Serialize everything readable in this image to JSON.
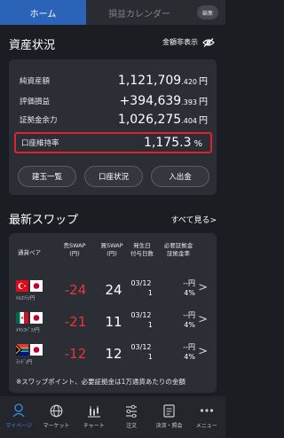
{
  "tabs": {
    "home": "ホーム",
    "calendar": "損益カレンダー",
    "edit": "編集"
  },
  "assets": {
    "title": "資産状況",
    "hide_label": "金額非表示",
    "rows": [
      {
        "label": "純資産額",
        "big": "1,121,709",
        "small": ".420",
        "unit": "円"
      },
      {
        "label": "評価損益",
        "big": "+394,639",
        "small": ".393",
        "unit": "円"
      },
      {
        "label": "証拠金余力",
        "big": "1,026,275",
        "small": ".404",
        "unit": "円"
      }
    ],
    "margin_rate": {
      "label": "口座維持率",
      "value": "1,175.3",
      "unit": "%"
    },
    "buttons": [
      "建玉一覧",
      "口座状況",
      "入出金"
    ]
  },
  "swap": {
    "title": "最新スワップ",
    "see_all": "すべて見る",
    "headers": {
      "pair": "通貨ペア",
      "sell": [
        "売SWAP",
        "(円)"
      ],
      "buy": [
        "買SWAP",
        "(円)"
      ],
      "days": [
        "発生日",
        "付与日数"
      ],
      "req": [
        "必要証拠金",
        "証拠金率"
      ]
    },
    "rows": [
      {
        "pair": "ﾄﾙｺﾘﾗ/円",
        "sell": "-24",
        "buy": "24",
        "date": "03/12",
        "days": "1",
        "req": "--円",
        "rate": "4%"
      },
      {
        "pair": "ﾒｷｼｺﾍﾟｿ/円",
        "sell": "-21",
        "buy": "11",
        "date": "03/12",
        "days": "1",
        "req": "--円",
        "rate": "4%"
      },
      {
        "pair": "ﾗﾝﾄﾞ/円",
        "sell": "-12",
        "buy": "12",
        "date": "03/12",
        "days": "1",
        "req": "--円",
        "rate": "4%"
      }
    ],
    "note": "※スワップポイント、必要証拠金は1万通貨あたりの金額"
  },
  "nav": [
    {
      "label": "マイページ",
      "icon": "person-icon"
    },
    {
      "label": "マーケット",
      "icon": "globe-icon"
    },
    {
      "label": "チャート",
      "icon": "chart-icon"
    },
    {
      "label": "注文",
      "icon": "order-icon"
    },
    {
      "label": "決済・照会",
      "icon": "document-icon"
    },
    {
      "label": "メニュー",
      "icon": "more-icon"
    }
  ],
  "colors": {
    "accent": "#2a63b8",
    "negative": "#e8353d",
    "highlight": "#e0222c",
    "nav_active": "#3d8bf1"
  }
}
